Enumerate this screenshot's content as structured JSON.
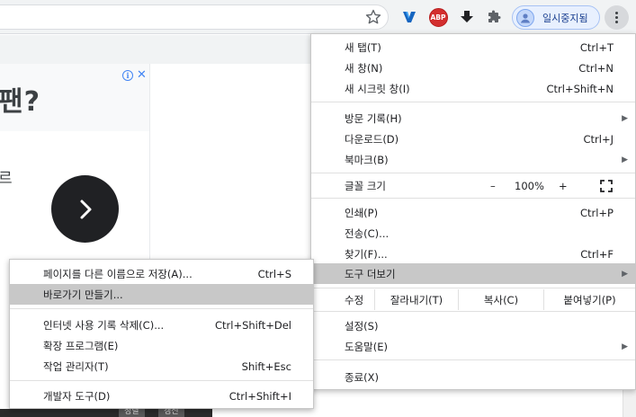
{
  "toolbar": {
    "profile_label": "일시중지됨",
    "abp_label": "ABP"
  },
  "page": {
    "ad_heading": "팬?",
    "ad_fragment": "르"
  },
  "bottom_bar": [
    "정렬",
    "갱신"
  ],
  "menu": {
    "new_tab": {
      "label": "새 탭(T)",
      "shortcut": "Ctrl+T"
    },
    "new_window": {
      "label": "새 창(N)",
      "shortcut": "Ctrl+N"
    },
    "incognito": {
      "label": "새 시크릿 창(I)",
      "shortcut": "Ctrl+Shift+N"
    },
    "history": {
      "label": "방문 기록(H)"
    },
    "downloads": {
      "label": "다운로드(D)",
      "shortcut": "Ctrl+J"
    },
    "bookmarks": {
      "label": "북마크(B)"
    },
    "zoom": {
      "label": "글꼴 크기",
      "minus": "–",
      "value": "100%",
      "plus": "+"
    },
    "print": {
      "label": "인쇄(P)",
      "shortcut": "Ctrl+P"
    },
    "cast": {
      "label": "전송(C)..."
    },
    "find": {
      "label": "찾기(F)...",
      "shortcut": "Ctrl+F"
    },
    "more_tools": {
      "label": "도구 더보기"
    },
    "edit": {
      "label": "수정",
      "cut": "잘라내기(T)",
      "copy": "복사(C)",
      "paste": "붙여넣기(P)"
    },
    "settings": {
      "label": "설정(S)"
    },
    "help": {
      "label": "도움말(E)"
    },
    "exit": {
      "label": "종료(X)"
    }
  },
  "submenu": {
    "save_page": {
      "label": "페이지를 다른 이름으로 저장(A)...",
      "shortcut": "Ctrl+S"
    },
    "create_shortcut": {
      "label": "바로가기 만들기..."
    },
    "clear_data": {
      "label": "인터넷 사용 기록 삭제(C)...",
      "shortcut": "Ctrl+Shift+Del"
    },
    "extensions": {
      "label": "확장 프로그램(E)"
    },
    "task_manager": {
      "label": "작업 관리자(T)",
      "shortcut": "Shift+Esc"
    },
    "dev_tools": {
      "label": "개발자 도구(D)",
      "shortcut": "Ctrl+Shift+I"
    }
  },
  "colors": {
    "highlight": "#c8c8c8",
    "profile_bg": "#e8f0fe",
    "abp_red": "#d32f2f"
  },
  "icons": [
    "star-icon",
    "vpn-extension-icon",
    "adblock-icon",
    "download-extension-icon",
    "extensions-puzzle-icon",
    "profile-avatar-icon",
    "kebab-menu-icon",
    "ad-info-icon",
    "ad-close-icon",
    "chevron-right-icon",
    "submenu-arrow-icon",
    "fullscreen-icon"
  ]
}
